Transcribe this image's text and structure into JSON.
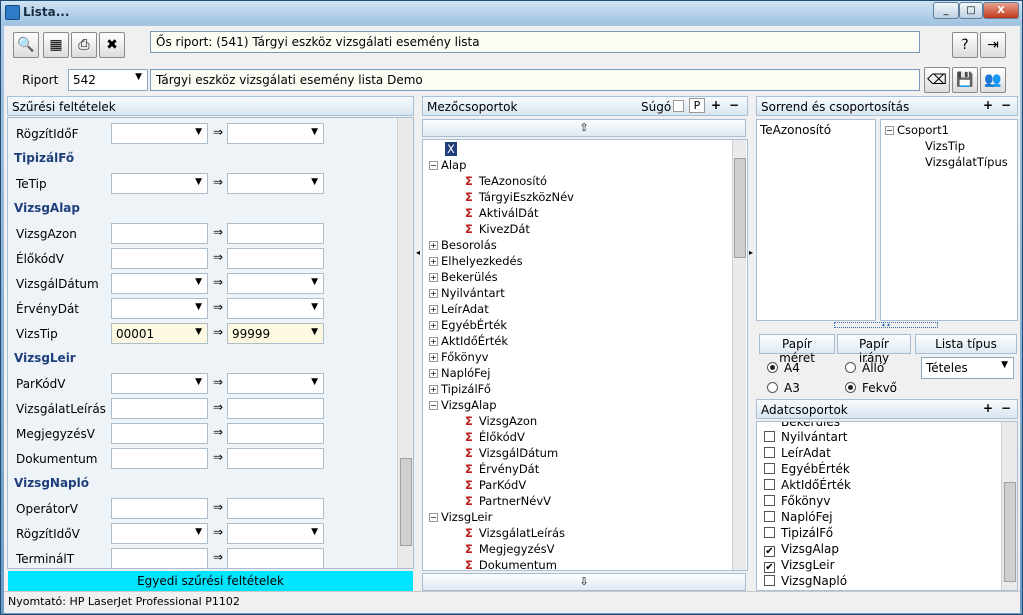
{
  "window": {
    "title": "Lista...",
    "buttons": [
      "_",
      "□",
      "X"
    ]
  },
  "toolbar": {
    "source_report": "Ős riport: (541)  Tárgyi eszköz vizsgálati esemény lista",
    "icons": [
      "preview-icon",
      "settings-icon",
      "print-icon",
      "export-icon"
    ]
  },
  "report": {
    "label": "Riport",
    "id": "542",
    "name": "Tárgyi eszköz vizsgálati esemény lista Demo"
  },
  "filters": {
    "title": "Szűrési feltételek",
    "arrow": "⇒",
    "rows": [
      {
        "type": "field",
        "label": "RögzítIdőF",
        "dd": true,
        "from": "",
        "to": ""
      },
      {
        "type": "section",
        "label": "TipizálFő"
      },
      {
        "type": "field",
        "label": "TeTip",
        "dd": true,
        "from": "",
        "to": ""
      },
      {
        "type": "section",
        "label": "VizsgAlap"
      },
      {
        "type": "field",
        "label": "VizsgAzon",
        "dd": false,
        "from": "",
        "to": ""
      },
      {
        "type": "field",
        "label": "ÉlőkódV",
        "dd": false,
        "from": "",
        "to": ""
      },
      {
        "type": "field",
        "label": "VizsgálDátum",
        "dd": true,
        "from": "",
        "to": ""
      },
      {
        "type": "field",
        "label": "ÉrvényDát",
        "dd": true,
        "from": "",
        "to": ""
      },
      {
        "type": "field",
        "label": "VizsTip",
        "dd": true,
        "from": "00001",
        "to": "99999",
        "highlight": true
      },
      {
        "type": "section",
        "label": "VizsgLeir"
      },
      {
        "type": "field",
        "label": "ParKódV",
        "dd": true,
        "from": "",
        "to": ""
      },
      {
        "type": "field",
        "label": "VizsgálatLeírás",
        "dd": false,
        "from": "",
        "to": ""
      },
      {
        "type": "field",
        "label": "MegjegyzésV",
        "dd": false,
        "from": "",
        "to": ""
      },
      {
        "type": "field",
        "label": "Dokumentum",
        "dd": false,
        "from": "",
        "to": ""
      },
      {
        "type": "section",
        "label": "VizsgNapló"
      },
      {
        "type": "field",
        "label": "OperátorV",
        "dd": false,
        "from": "",
        "to": ""
      },
      {
        "type": "field",
        "label": "RögzítIdőV",
        "dd": true,
        "from": "",
        "to": ""
      },
      {
        "type": "field",
        "label": "TerminálT",
        "dd": false,
        "from": "",
        "to": ""
      }
    ],
    "custom_button": "Egyedi szűrési feltételek"
  },
  "fieldgroups": {
    "title": "Mezőcsoportok",
    "help_label": "Súgó",
    "p_label": "P",
    "tree": [
      {
        "kind": "x",
        "label": "X",
        "level": 0
      },
      {
        "kind": "group",
        "label": "Alap",
        "open": true
      },
      {
        "kind": "field",
        "label": "TeAzonosító"
      },
      {
        "kind": "field",
        "label": "TárgyiEszközNév"
      },
      {
        "kind": "field",
        "label": "AktiválDát"
      },
      {
        "kind": "field",
        "label": "KivezDát"
      },
      {
        "kind": "group",
        "label": "Besorolás"
      },
      {
        "kind": "group",
        "label": "Elhelyezkedés"
      },
      {
        "kind": "group",
        "label": "Bekerülés"
      },
      {
        "kind": "group",
        "label": "Nyilvántart"
      },
      {
        "kind": "group",
        "label": "LeírAdat"
      },
      {
        "kind": "group",
        "label": "EgyébÉrték"
      },
      {
        "kind": "group",
        "label": "AktIdőÉrték"
      },
      {
        "kind": "group",
        "label": "Főkönyv"
      },
      {
        "kind": "group",
        "label": "NaplóFej"
      },
      {
        "kind": "group",
        "label": "TipizálFő"
      },
      {
        "kind": "group",
        "label": "VizsgAlap",
        "open": true
      },
      {
        "kind": "field",
        "label": "VizsgAzon"
      },
      {
        "kind": "field",
        "label": "ÉlőkódV"
      },
      {
        "kind": "field",
        "label": "VizsgálDátum"
      },
      {
        "kind": "field",
        "label": "ÉrvényDát"
      },
      {
        "kind": "field",
        "label": "ParKódV"
      },
      {
        "kind": "field",
        "label": "PartnerNévV"
      },
      {
        "kind": "group",
        "label": "VizsgLeir",
        "open": true
      },
      {
        "kind": "field",
        "label": "VizsgálatLeírás"
      },
      {
        "kind": "field",
        "label": "MegjegyzésV"
      },
      {
        "kind": "field",
        "label": "Dokumentum"
      }
    ]
  },
  "ordering": {
    "title": "Sorrend és csoportosítás",
    "order_list": [
      "TeAzonosító"
    ],
    "groups": {
      "root": "Csoport1",
      "children": [
        "VizsTip",
        "VizsgálatTípus"
      ]
    }
  },
  "paper": {
    "size_label": "Papír méret",
    "orient_label": "Papír irány",
    "list_type_label": "Lista típus",
    "sizes": [
      {
        "label": "A4",
        "on": true
      },
      {
        "label": "A3",
        "on": false
      }
    ],
    "orients": [
      {
        "label": "Álló",
        "on": false
      },
      {
        "label": "Fekvő",
        "on": true
      }
    ],
    "list_type": "Tételes"
  },
  "datagroups": {
    "title": "Adatcsoportok",
    "partial": "Bekerülés",
    "items": [
      {
        "label": "Nyilvántart",
        "on": false
      },
      {
        "label": "LeírAdat",
        "on": false
      },
      {
        "label": "EgyébÉrték",
        "on": false
      },
      {
        "label": "AktIdőÉrték",
        "on": false
      },
      {
        "label": "Főkönyv",
        "on": false
      },
      {
        "label": "NaplóFej",
        "on": false
      },
      {
        "label": "TipizálFő",
        "on": false
      },
      {
        "label": "VizsgAlap",
        "on": true
      },
      {
        "label": "VizsgLeir",
        "on": true
      },
      {
        "label": "VizsgNapló",
        "on": false
      }
    ]
  },
  "status": {
    "printer": "Nyomtató: HP LaserJet Professional P1102"
  },
  "colors": {
    "accent": "#00e5ff",
    "highlight": "#fdf8e1",
    "sigma": "#c01a1a",
    "section": "#1f3f7a"
  }
}
